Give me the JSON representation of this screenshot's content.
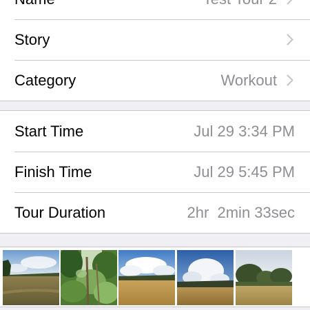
{
  "general": {
    "rows": [
      {
        "label": "Name",
        "value": "Test Tour 2",
        "icon": "chevron-right-icon"
      },
      {
        "label": "Story",
        "value": "",
        "icon": "chevron-right-icon"
      },
      {
        "label": "Category",
        "value": "Workout",
        "icon": "chevron-right-icon"
      }
    ]
  },
  "timing": {
    "start_label": "Start Time",
    "start_value": "Jul 29 3:34 PM",
    "finish_label": "Finish Time",
    "finish_value": "Jul 29 5:45 PM",
    "duration_label": "Tour Duration",
    "duration_value": "2hr  2min 33sec"
  },
  "colors": {
    "background": "#efeff4",
    "cell": "#ffffff",
    "separator": "#c8c7cc",
    "secondary_text": "#8e8e93",
    "chevron": "#c7c7cc"
  },
  "photos": [
    {
      "scene": "cloudy sky over a harvested field with a tree line"
    },
    {
      "scene": "green trees and foliage"
    },
    {
      "scene": "white cumulus clouds over a golden wheat field"
    },
    {
      "scene": "dramatic clouds over a field with distant trees"
    },
    {
      "scene": "trees beside a stubble field under a pale sky"
    }
  ]
}
